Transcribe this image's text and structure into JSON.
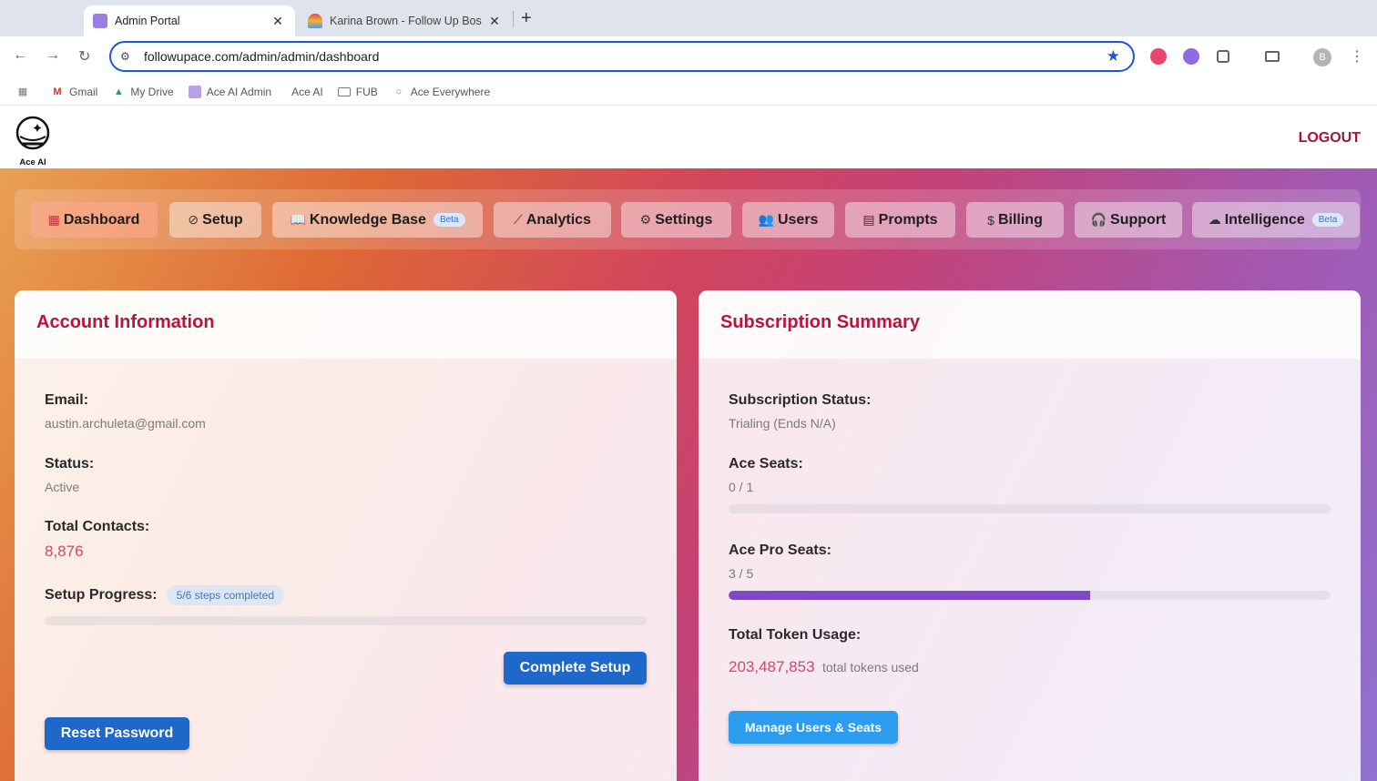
{
  "browser": {
    "tabs": [
      {
        "title": "Admin Portal",
        "favicon_color": "#9b7fe0"
      },
      {
        "title": "Karina Brown - Follow Up Bos",
        "favicon_color": "#e8a33b"
      }
    ],
    "url": "followupace.com/admin/admin/dashboard",
    "profile_initial": "B",
    "bookmarks": [
      {
        "label": "Gmail",
        "icon": "gmail-icon"
      },
      {
        "label": "My Drive",
        "icon": "drive-icon"
      },
      {
        "label": "Ace AI Admin",
        "icon": "ace-admin-icon"
      },
      {
        "label": "Ace AI",
        "icon": "ace-icon"
      },
      {
        "label": "FUB",
        "icon": "folder-icon"
      },
      {
        "label": "Ace Everywhere",
        "icon": "bulb-icon"
      }
    ]
  },
  "app": {
    "logo_text": "Ace AI",
    "logout_label": "LOGOUT"
  },
  "nav": {
    "items": [
      {
        "label": "Dashboard",
        "icon": "grid-icon",
        "active": true
      },
      {
        "label": "Setup",
        "icon": "check-circle-icon"
      },
      {
        "label": "Knowledge Base",
        "icon": "book-icon",
        "badge": "Beta"
      },
      {
        "label": "Analytics",
        "icon": "chart-line-icon"
      },
      {
        "label": "Settings",
        "icon": "gear-icon"
      },
      {
        "label": "Users",
        "icon": "users-icon"
      },
      {
        "label": "Prompts",
        "icon": "note-icon"
      },
      {
        "label": "Billing",
        "icon": "dollar-icon"
      },
      {
        "label": "Support",
        "icon": "headset-icon"
      },
      {
        "label": "Intelligence",
        "icon": "brain-icon",
        "badge": "Beta"
      }
    ]
  },
  "account": {
    "title": "Account Information",
    "email_label": "Email:",
    "email": "austin.archuleta@gmail.com",
    "status_label": "Status:",
    "status": "Active",
    "contacts_label": "Total Contacts:",
    "contacts": "8,876",
    "setup_label": "Setup Progress:",
    "setup_pill": "5/6 steps completed",
    "setup_progress": 0,
    "complete_button": "Complete Setup",
    "reset_button": "Reset Password"
  },
  "subscription": {
    "title": "Subscription Summary",
    "status_label": "Subscription Status:",
    "status": "Trialing (Ends N/A)",
    "ace_seats_label": "Ace Seats:",
    "ace_seats": "0 / 1",
    "ace_seats_fraction": 0,
    "pro_seats_label": "Ace Pro Seats:",
    "pro_seats": "3 / 5",
    "pro_seats_fraction": 0.6,
    "token_label": "Total Token Usage:",
    "tokens": "203,487,853",
    "tokens_suffix": "total tokens used",
    "manage_button": "Manage Users & Seats"
  },
  "colors": {
    "accent": "#b8153c",
    "primary_button": "#1d68c8",
    "secondary_button": "#2b9cee",
    "progress_fill": "#7e49c2"
  }
}
